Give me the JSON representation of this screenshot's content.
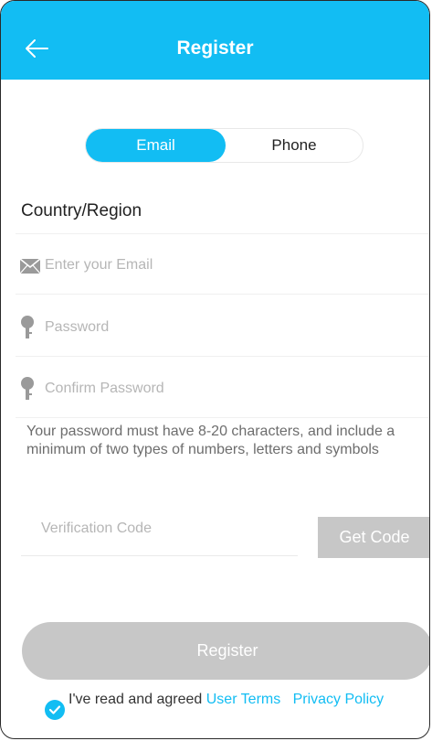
{
  "header": {
    "title": "Register",
    "back_icon": "arrow-left-icon",
    "color": "#12bdf3"
  },
  "tabs": {
    "email_label": "Email",
    "phone_label": "Phone",
    "selected": "Email"
  },
  "form": {
    "country_label": "Country/Region",
    "email_placeholder": "Enter your Email",
    "email_icon": "envelope-icon",
    "password_placeholder": "Password",
    "password_icon": "key-icon",
    "confirm_placeholder": "Confirm Password",
    "confirm_icon": "key-icon",
    "hint": "Your password must have 8-20 characters, and include a minimum of two types of numbers, letters and symbols",
    "verification_placeholder": "Verification Code",
    "get_code_label": "Get Code"
  },
  "footer": {
    "register_label": "Register",
    "agree_text": "I've read and agreed",
    "user_terms": "User Terms",
    "privacy_policy": "Privacy Policy",
    "checked": true,
    "check_icon": "checkmark-circle-icon"
  }
}
